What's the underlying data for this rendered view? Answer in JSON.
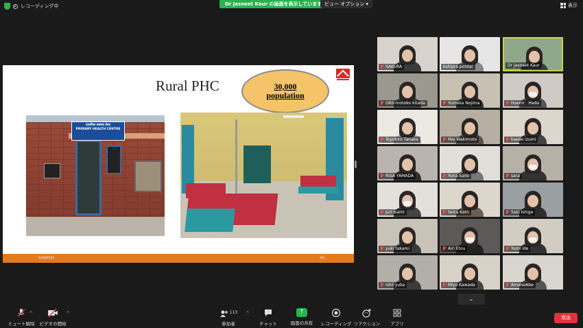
{
  "top_bar": {
    "recording_label": "レコーディング中",
    "share_banner": "Dr Jasneet Kaur の画面を表示しています",
    "view_options": "ビュー オプション ▾",
    "display_label": "表示"
  },
  "slide": {
    "title": "Rural PHC",
    "bubble_value": "30,000",
    "bubble_label": "population",
    "sign_line1": "प्राथमिक स्वास्थ्य केन्द्र",
    "sign_line2": "PRIMARY HEALTH CENTRE",
    "date": "4/26/2022",
    "page_num": "3/3"
  },
  "participants": [
    {
      "name": "SAKURA",
      "muted": true,
      "mask": false,
      "bg": "#d8d3cc",
      "shirt": "#3a3a3a"
    },
    {
      "name": "kshipra potdar",
      "muted": false,
      "mask": false,
      "bg": "#e6e6e6",
      "shirt": "#888"
    },
    {
      "name": "Dr Jasneet Kaur",
      "muted": false,
      "mask": false,
      "bg": "#8fa78a",
      "shirt": "#3a3f45",
      "active": true
    },
    {
      "name": "OBS-motoko kitada",
      "muted": true,
      "mask": false,
      "bg": "#9b9890",
      "shirt": "#444"
    },
    {
      "name": "Yumeka Nojima",
      "muted": true,
      "mask": false,
      "bg": "#c8c0b2",
      "shirt": "#333"
    },
    {
      "name": "Hoemi　Hada",
      "muted": true,
      "mask": true,
      "bg": "#cfcac4",
      "shirt": "#555"
    },
    {
      "name": "Toyohiro Tanaka",
      "muted": true,
      "mask": false,
      "bg": "#ece8e2",
      "shirt": "#bbb"
    },
    {
      "name": "Mai Wakimoto",
      "muted": true,
      "mask": false,
      "bg": "#b7afa2",
      "shirt": "#5a5450"
    },
    {
      "name": "kaede izumi",
      "muted": true,
      "mask": false,
      "bg": "#ddd6cc",
      "shirt": "#444"
    },
    {
      "name": "RISA YAMADA",
      "muted": true,
      "mask": false,
      "bg": "#b9b4ad",
      "shirt": "#2e2e2e"
    },
    {
      "name": "Yuna Saito",
      "muted": true,
      "mask": false,
      "bg": "#e2dfdb",
      "shirt": "#777"
    },
    {
      "name": "sara",
      "muted": true,
      "mask": true,
      "bg": "#b7b0a6",
      "shirt": "#333"
    },
    {
      "name": "Juri Isami",
      "muted": true,
      "mask": true,
      "bg": "#e3e0dc",
      "shirt": "#444"
    },
    {
      "name": "Seira Kato",
      "muted": true,
      "mask": false,
      "bg": "#dcd6cd",
      "shirt": "#6a5e55"
    },
    {
      "name": "Saki Ishige",
      "muted": true,
      "mask": false,
      "bg": "#9aa0a2",
      "shirt": "#2d2d2d"
    },
    {
      "name": "yuki takami",
      "muted": true,
      "mask": false,
      "bg": "#c9c2b8",
      "shirt": "#3a3a3a"
    },
    {
      "name": "Airi Etou",
      "muted": true,
      "mask": true,
      "bg": "#5c5a58",
      "shirt": "#222"
    },
    {
      "name": "Yumi Ide",
      "muted": true,
      "mask": true,
      "bg": "#d3ccc2",
      "shirt": "#333"
    },
    {
      "name": "ishii yuka",
      "muted": true,
      "mask": false,
      "bg": "#b2aea8",
      "shirt": "#3b3b3b"
    },
    {
      "name": "Miyu Kawada",
      "muted": true,
      "mask": false,
      "bg": "#d7d1c7",
      "shirt": "#444"
    },
    {
      "name": "AmaneAbe",
      "muted": true,
      "mask": false,
      "bg": "#d9d5cf",
      "shirt": "#555"
    }
  ],
  "expand_icon": "chevron-down",
  "toolbar": {
    "unmute": "ミュート解除",
    "start_video": "ビデオの開始",
    "participants": "参加者",
    "participant_count": "113",
    "chat": "チャット",
    "share_screen": "画面の共有",
    "record": "レコーディング",
    "reactions": "リアクション",
    "apps": "アプリ",
    "leave": "退出"
  },
  "colors": {
    "share_green": "#2bb24c",
    "leave_red": "#e0333b",
    "slide_footer": "#e47a1e",
    "active_border": "#c7d83a"
  }
}
